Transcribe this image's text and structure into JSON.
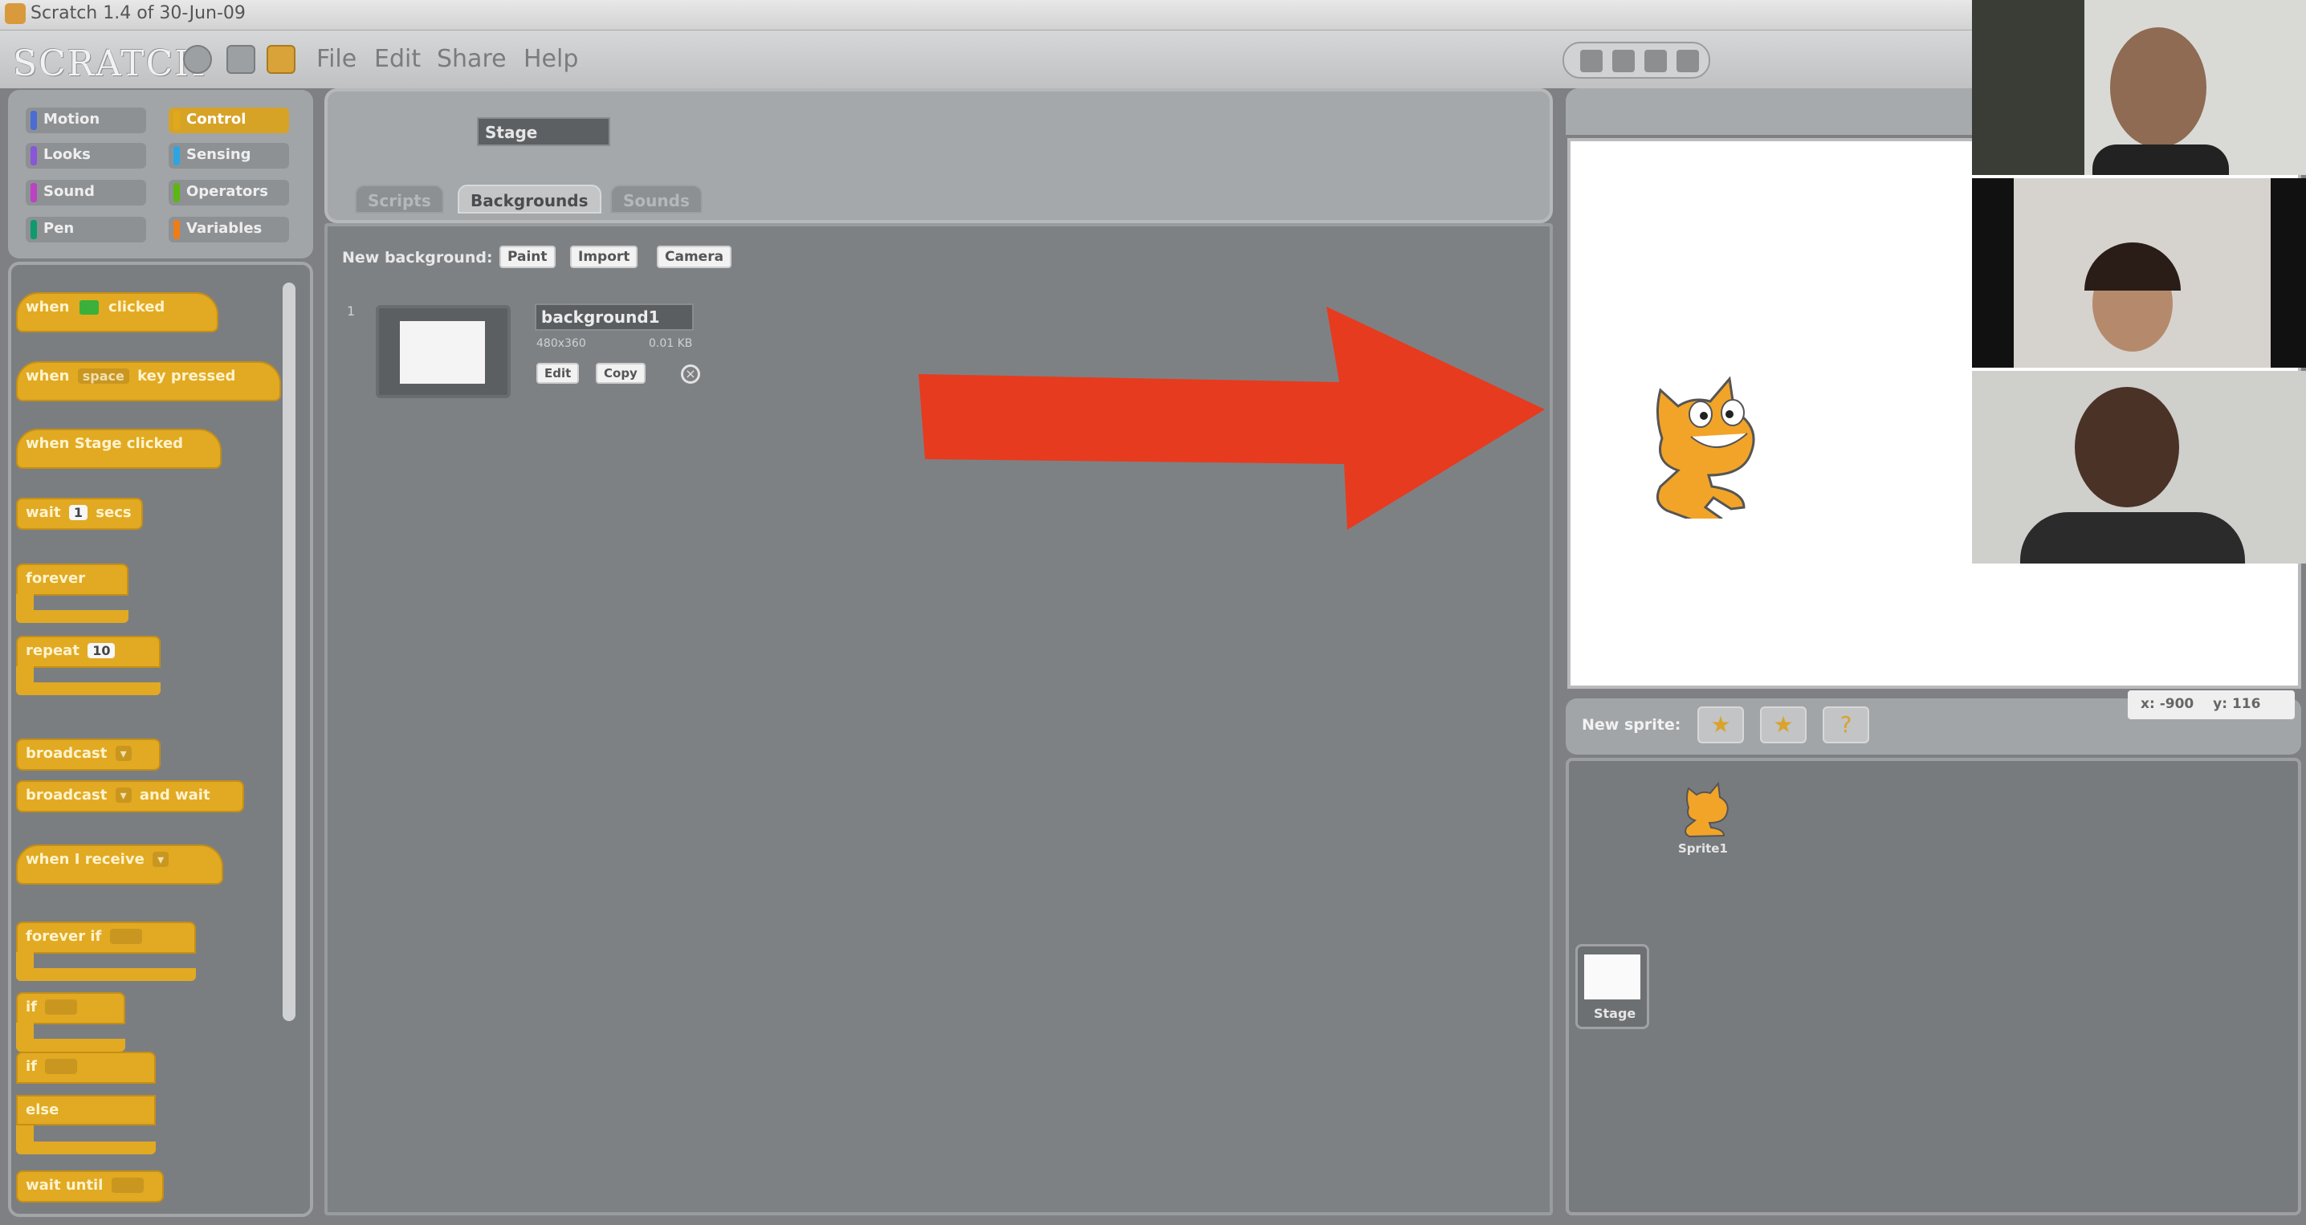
{
  "window": {
    "title": "Scratch 1.4 of 30-Jun-09"
  },
  "toolbar": {
    "logo": "SCRATCH",
    "menus": [
      "File",
      "Edit",
      "Share",
      "Help"
    ]
  },
  "palette": {
    "categories": [
      {
        "label": "Motion",
        "color": "#4a6cd4"
      },
      {
        "label": "Control",
        "color": "#e1a91a"
      },
      {
        "label": "Looks",
        "color": "#8a55d7"
      },
      {
        "label": "Sensing",
        "color": "#2ca5e2"
      },
      {
        "label": "Sound",
        "color": "#bb42c3"
      },
      {
        "label": "Operators",
        "color": "#5cb712"
      },
      {
        "label": "Pen",
        "color": "#0e9a6c"
      },
      {
        "label": "Variables",
        "color": "#ee7d16"
      }
    ],
    "blocks": {
      "when_flag": {
        "pre": "when",
        "post": "clicked"
      },
      "when_key": {
        "pre": "when",
        "key": "space",
        "post": "key pressed"
      },
      "when_stage": "when Stage clicked",
      "wait": {
        "pre": "wait",
        "value": "1",
        "post": "secs"
      },
      "forever": "forever",
      "repeat": {
        "pre": "repeat",
        "value": "10"
      },
      "broadcast": "broadcast",
      "broadcast_wait": {
        "pre": "broadcast",
        "post": "and wait"
      },
      "when_receive": "when I receive",
      "forever_if": "forever if",
      "if": "if",
      "if_else_if": "if",
      "else": "else",
      "wait_until": "wait until"
    }
  },
  "sprite_header": {
    "name": "Stage",
    "tabs": [
      {
        "label": "Scripts",
        "active": false
      },
      {
        "label": "Backgrounds",
        "active": true
      },
      {
        "label": "Sounds",
        "active": false
      }
    ]
  },
  "backgrounds": {
    "new_label": "New background:",
    "buttons": [
      "Paint",
      "Import",
      "Camera"
    ],
    "items": [
      {
        "index": "1",
        "name": "background1",
        "size": "480x360",
        "filesize": "0.01 KB",
        "edit": "Edit",
        "copy": "Copy"
      }
    ]
  },
  "annotation": {
    "arrow_color": "#e63b1f",
    "direction": "right"
  },
  "stage_panel": {
    "new_sprite_label": "New sprite:",
    "coords": {
      "x_label": "x:",
      "x": "-900",
      "y_label": "y:",
      "y": "116"
    },
    "sprites": [
      {
        "name": "Sprite1"
      }
    ],
    "stage_label": "Stage"
  },
  "video_call": {
    "participants": 3
  }
}
